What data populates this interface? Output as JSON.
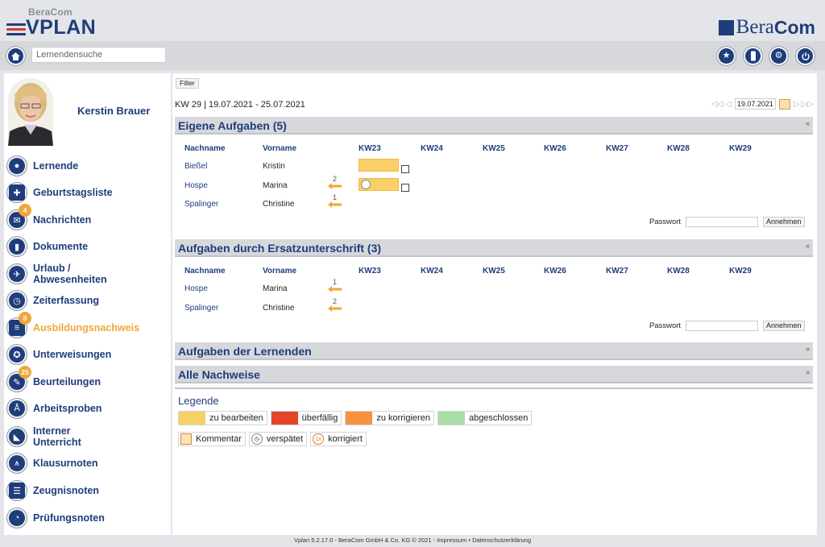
{
  "header": {
    "logo_small": "BeraCom",
    "logo_big": "VPLAN",
    "brand_part1": "Bera",
    "brand_part2": "Com"
  },
  "toolbar": {
    "search_placeholder": "Lernendensuche"
  },
  "user": {
    "name": "Kerstin Brauer"
  },
  "sidebar": {
    "items": [
      {
        "label": "Lernende",
        "icon": "person-icon"
      },
      {
        "label": "Geburtstagsliste",
        "icon": "gift-icon"
      },
      {
        "label": "Nachrichten",
        "icon": "envelope-icon",
        "badge": "4"
      },
      {
        "label": "Dokumente",
        "icon": "document-icon"
      },
      {
        "label": "Urlaub /\nAbwesenheiten",
        "icon": "plane-icon"
      },
      {
        "label": "Zeiterfassung",
        "icon": "clock-icon"
      },
      {
        "label": "Ausbildungsnachweis",
        "icon": "clipboard-icon",
        "badge": "8",
        "active": true
      },
      {
        "label": "Unterweisungen",
        "icon": "award-icon"
      },
      {
        "label": "Beurteilungen",
        "icon": "evaluation-icon",
        "badge": "25"
      },
      {
        "label": "Arbeitsproben",
        "icon": "compass-icon"
      },
      {
        "label": "Interner\nUnterricht",
        "icon": "ruler-icon"
      },
      {
        "label": "Klausurnoten",
        "icon": "chart-icon"
      },
      {
        "label": "Zeugnisnoten",
        "icon": "certificate-icon"
      },
      {
        "label": "Prüfungsnoten",
        "icon": "pie-icon"
      }
    ]
  },
  "main": {
    "filter_label": "Filter",
    "week_range": "KW 29 | 19.07.2021 - 25.07.2021",
    "date_value": "19.07.2021",
    "columns": {
      "lastname": "Nachname",
      "firstname": "Vorname",
      "weeks": [
        "KW23",
        "KW24",
        "KW25",
        "KW26",
        "KW27",
        "KW28",
        "KW29"
      ]
    },
    "section1": {
      "title": "Eigene Aufgaben (5)",
      "rows": [
        {
          "last": "Bießel",
          "first": "Kristin",
          "arrow": ""
        },
        {
          "last": "Hospe",
          "first": "Marina",
          "arrow": "2"
        },
        {
          "last": "Spalinger",
          "first": "Christine",
          "arrow": "1"
        }
      ]
    },
    "section2": {
      "title": "Aufgaben durch Ersatzunterschrift (3)",
      "rows": [
        {
          "last": "Hospe",
          "first": "Marina",
          "arrow": "1"
        },
        {
          "last": "Spalinger",
          "first": "Christine",
          "arrow": "2"
        }
      ]
    },
    "section3": {
      "title": "Aufgaben der Lernenden"
    },
    "section4": {
      "title": "Alle Nachweise"
    },
    "password_label": "Passwort",
    "accept_label": "Annehmen",
    "collapse_glyph": "«",
    "expand_glyph": "»"
  },
  "legend": {
    "title": "Legende",
    "colors": [
      {
        "label": "zu bearbeiten",
        "color": "#f9cf68"
      },
      {
        "label": "überfällig",
        "color": "#e4442a"
      },
      {
        "label": "zu korrigieren",
        "color": "#f7923e"
      },
      {
        "label": "abgeschlossen",
        "color": "#a9dfa6"
      }
    ],
    "icons": [
      {
        "label": "Kommentar",
        "icon": "comment-icon"
      },
      {
        "label": "verspätet",
        "icon": "clock-icon"
      },
      {
        "label": "korrigiert",
        "icon": "corrected-icon"
      }
    ]
  },
  "footer": "Vplan 5.2.17.0 - BeraCom GmbH & Co. KG © 2021 - Impressum • Datenschutzerklärung"
}
